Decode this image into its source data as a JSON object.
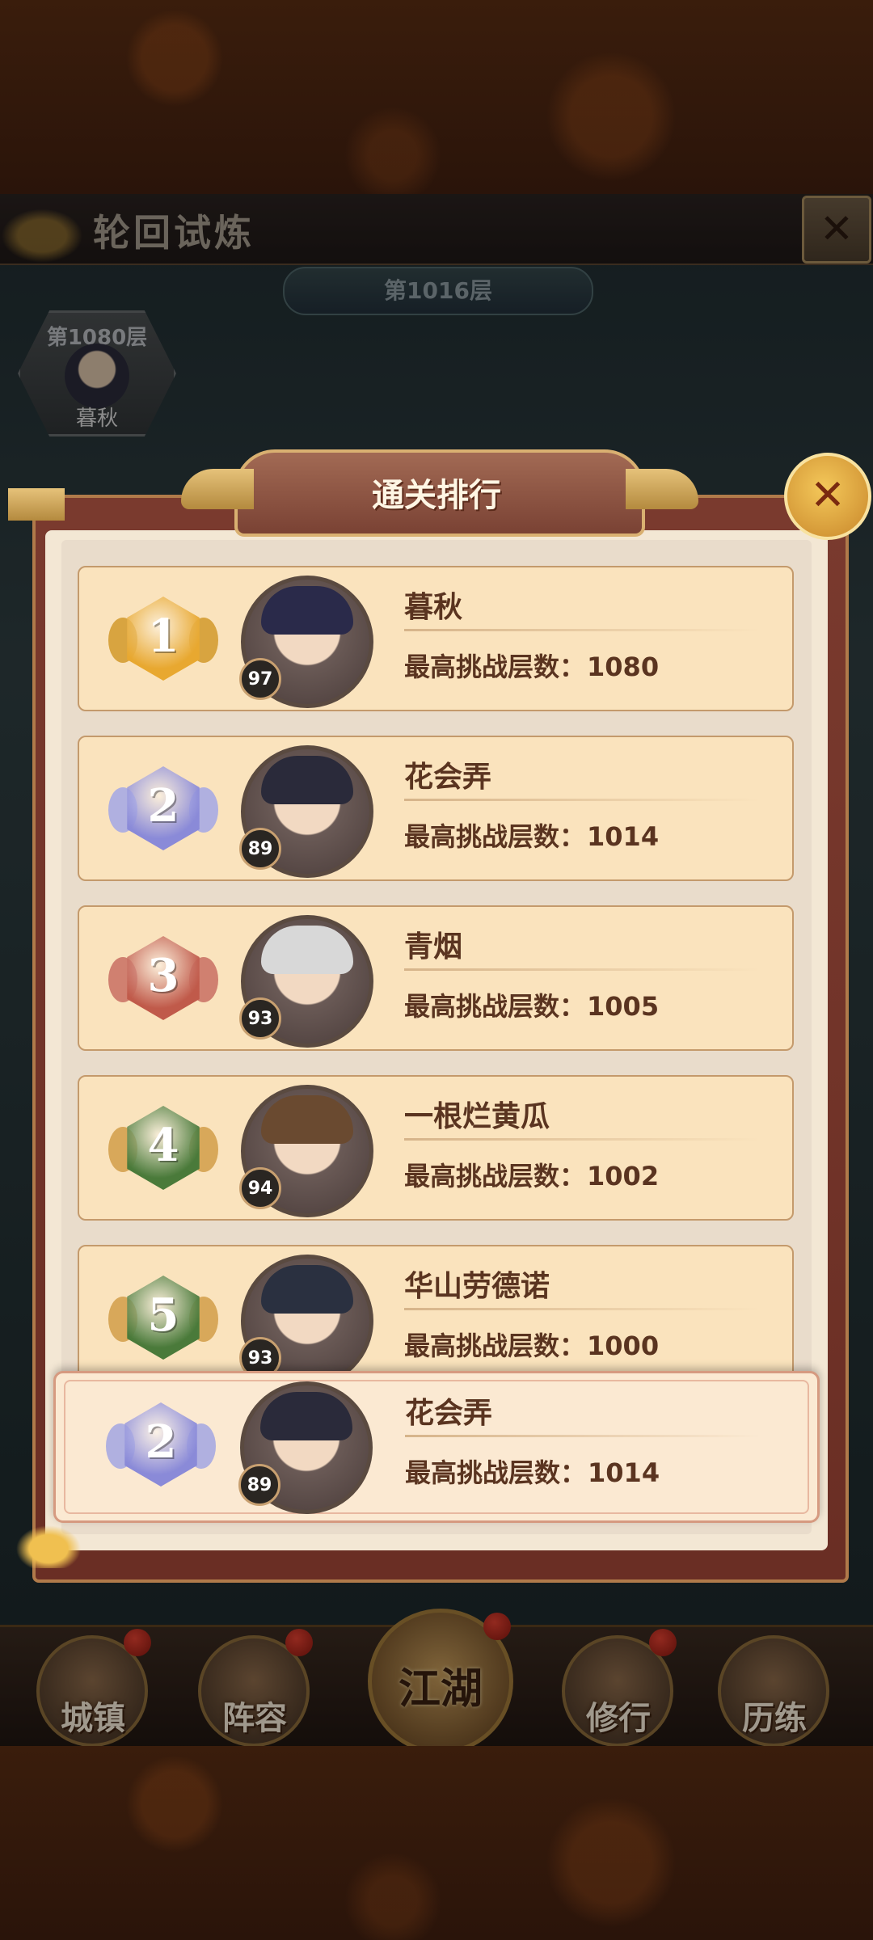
{
  "header": {
    "title": "轮回试炼",
    "floor_banner": "第1016层",
    "best": {
      "floor": "第1080层",
      "name": "暮秋"
    }
  },
  "modal": {
    "title": "通关排行",
    "close_icon": "close-icon",
    "rows": [
      {
        "rank": "1",
        "level": "97",
        "name": "暮秋",
        "label": "最高挑战层数：",
        "value": "1080",
        "medal_color": "#e8a830"
      },
      {
        "rank": "2",
        "level": "89",
        "name": "花会弄",
        "label": "最高挑战层数：",
        "value": "1014",
        "medal_color": "#8a8ad8"
      },
      {
        "rank": "3",
        "level": "93",
        "name": "青烟",
        "label": "最高挑战层数：",
        "value": "1005",
        "medal_color": "#c05a4a"
      },
      {
        "rank": "4",
        "level": "94",
        "name": "一根烂黄瓜",
        "label": "最高挑战层数：",
        "value": "1002",
        "medal_color": "#4a7a3a"
      },
      {
        "rank": "5",
        "level": "93",
        "name": "华山劳德诺",
        "label": "最高挑战层数：",
        "value": "1000",
        "medal_color": "#4a7a3a"
      }
    ],
    "mine": {
      "rank": "2",
      "level": "89",
      "name": "花会弄",
      "label": "最高挑战层数：",
      "value": "1014",
      "medal_color": "#8a8ad8"
    }
  },
  "nav": {
    "items": [
      "城镇",
      "阵容",
      "江湖",
      "修行",
      "历练"
    ]
  }
}
